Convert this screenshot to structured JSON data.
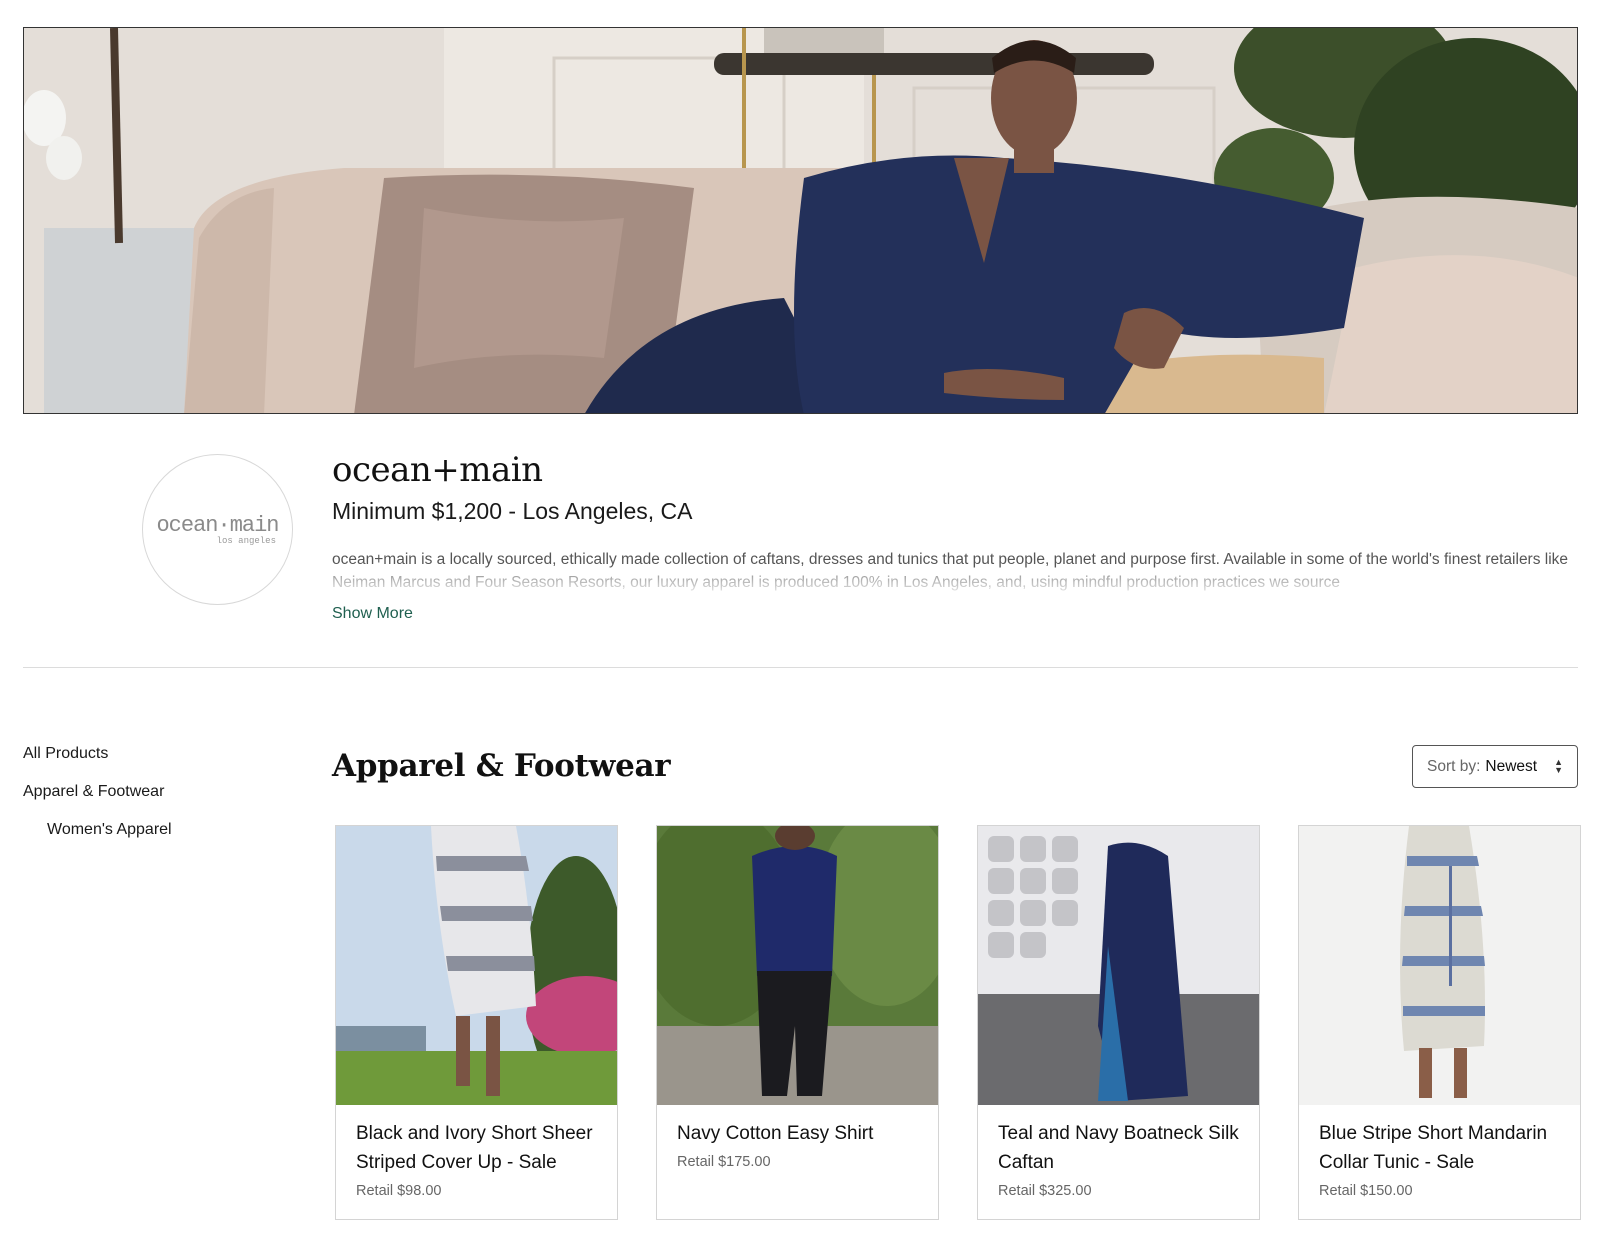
{
  "brand": {
    "name": "ocean+main",
    "meta": "Minimum $1,200 - Los Angeles, CA",
    "logo_text": "ocean·main",
    "logo_subtext": "los angeles",
    "description": "ocean+main is a locally sourced, ethically made collection of caftans, dresses and tunics that put people, planet and purpose first.  Available in some of the world's finest retailers like Neiman Marcus and Four Season Resorts, our luxury apparel is produced 100% in Los Angeles, and, using mindful production practices we source",
    "show_more_label": "Show More"
  },
  "sidebar": {
    "items": [
      {
        "label": "All Products"
      },
      {
        "label": "Apparel & Footwear"
      },
      {
        "label": "Women's Apparel"
      }
    ]
  },
  "section": {
    "title": "Apparel & Footwear",
    "sort_label": "Sort by:",
    "sort_value": "Newest"
  },
  "products": [
    {
      "name": "Black and Ivory Short Sheer Striped Cover Up - Sale",
      "price": "Retail $98.00"
    },
    {
      "name": "Navy Cotton Easy Shirt",
      "price": "Retail $175.00"
    },
    {
      "name": "Teal and Navy Boatneck Silk Caftan",
      "price": "Retail $325.00"
    },
    {
      "name": "Blue Stripe Short Mandarin Collar Tunic - Sale",
      "price": "Retail $150.00"
    }
  ],
  "colors": {
    "accent_link": "#1f5f4f",
    "navy": "#1f2a4d",
    "border": "#d4d4d4"
  }
}
